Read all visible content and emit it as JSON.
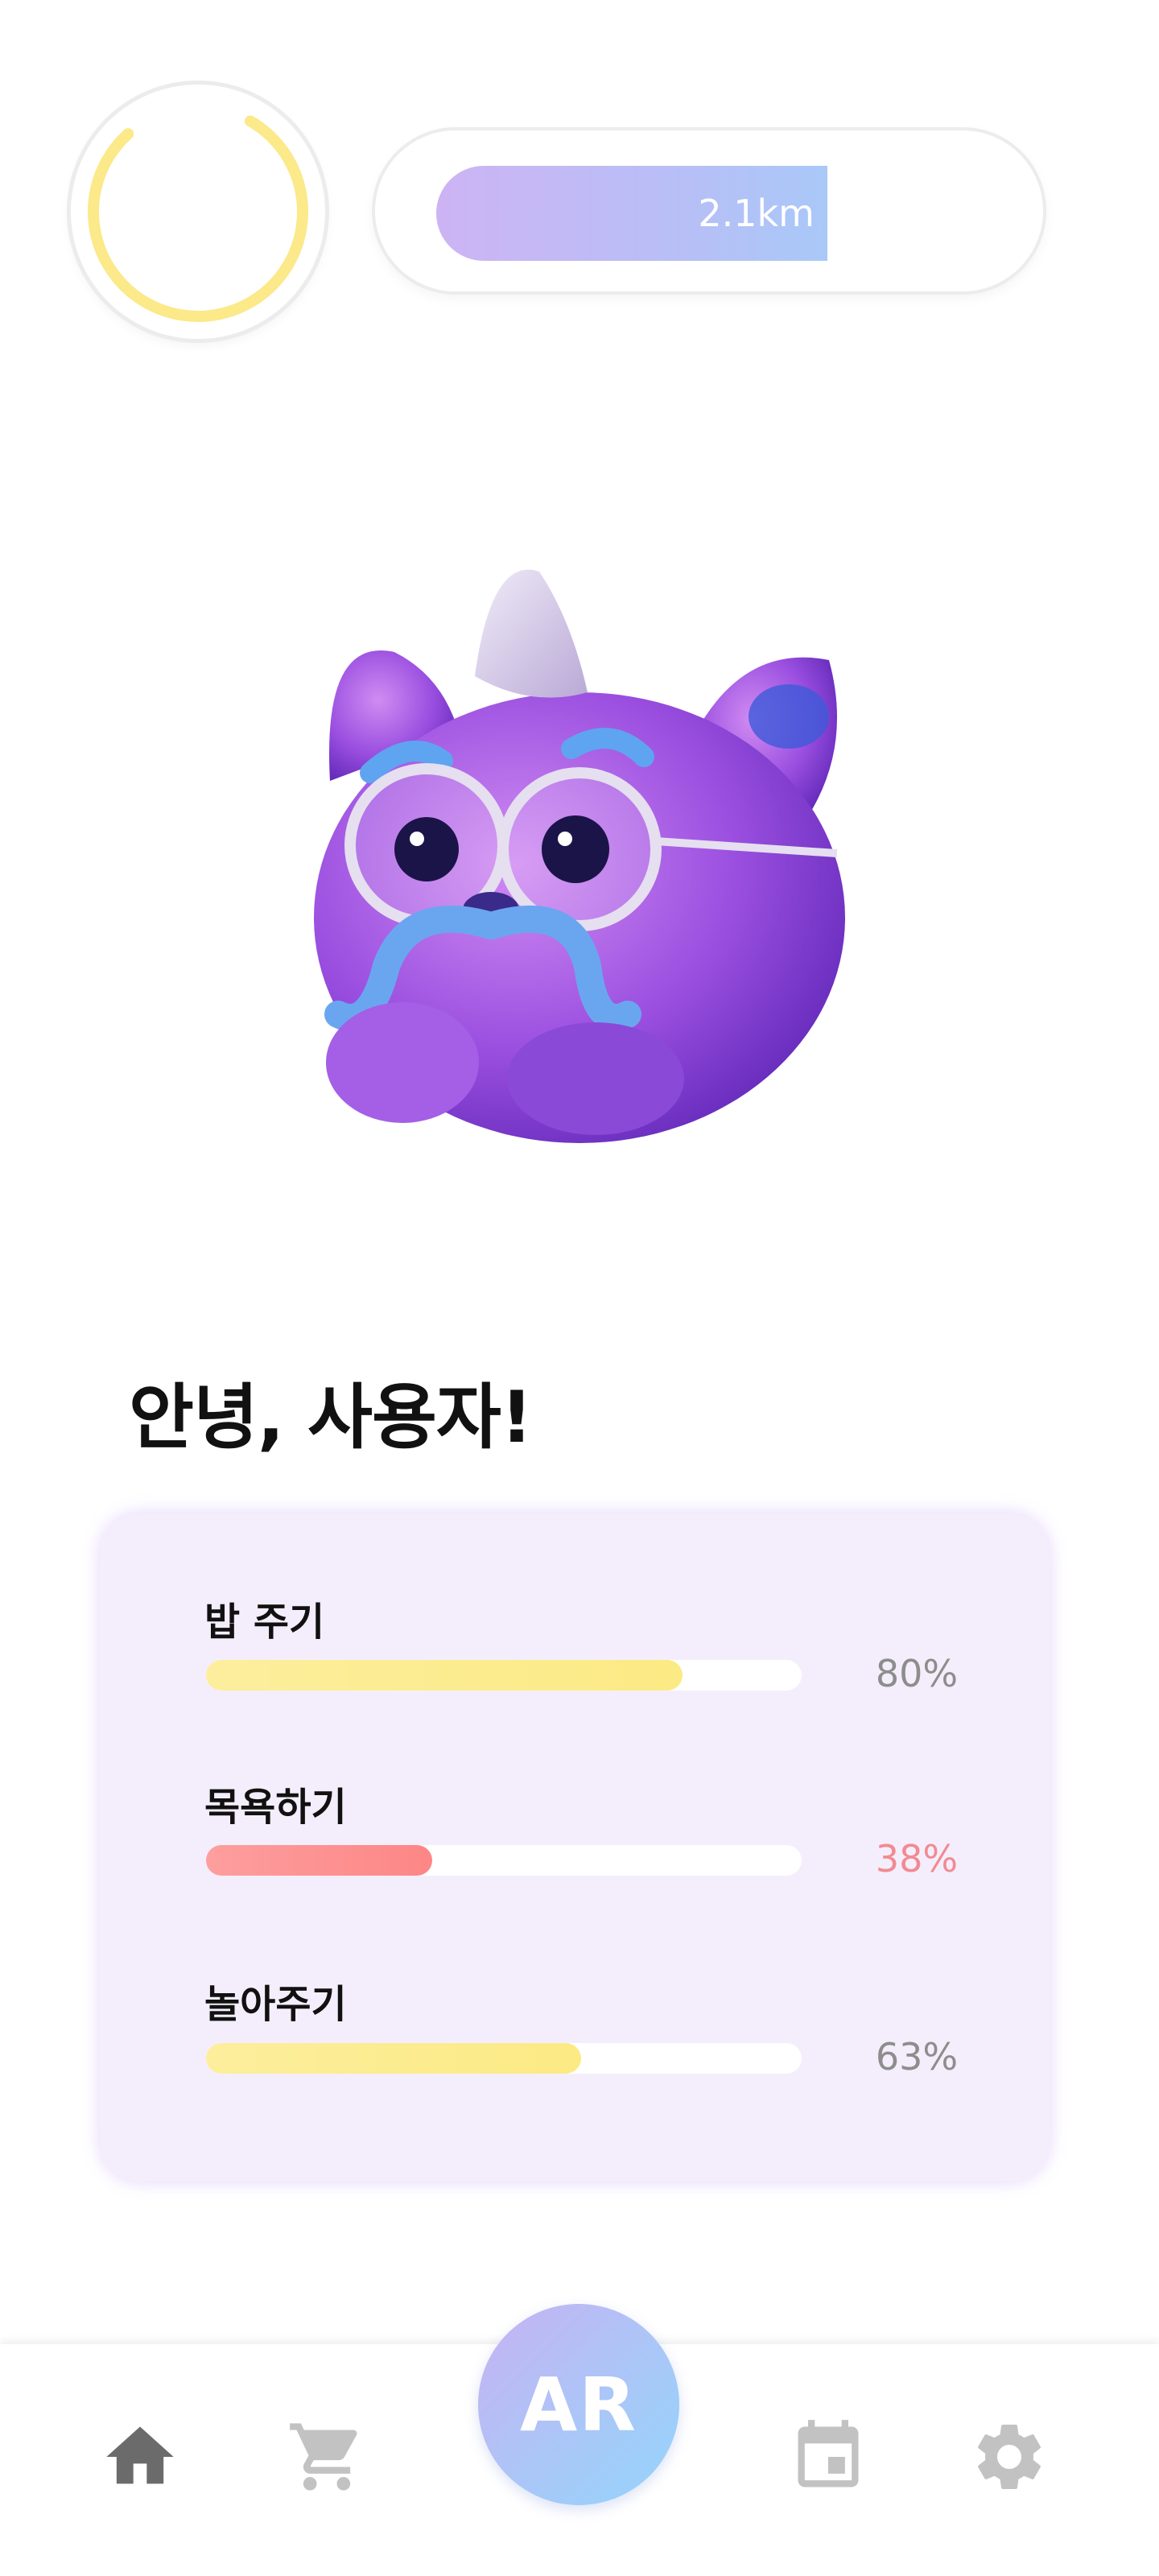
{
  "status": {
    "ring_progress": 0.8,
    "ring_color": "#fbe98a",
    "distance_text": "2.1km",
    "distance_progress": 0.6
  },
  "greeting": "안녕, 사용자!",
  "stats": [
    {
      "label": "밥 주기",
      "percent": 80,
      "percent_text": "80%",
      "color": "#fcea84",
      "text_color": "#8d8d8d"
    },
    {
      "label": "목욕하기",
      "percent": 38,
      "percent_text": "38%",
      "color": "#fd8686",
      "text_color": "#f28a92"
    },
    {
      "label": "놀아주기",
      "percent": 63,
      "percent_text": "63%",
      "color": "#fcea84",
      "text_color": "#8d8d8d"
    }
  ],
  "nav": {
    "items": [
      {
        "icon": "home-icon",
        "active": true
      },
      {
        "icon": "cart-icon",
        "active": false
      },
      {
        "icon": "calendar-icon",
        "active": false
      },
      {
        "icon": "gear-icon",
        "active": false
      }
    ],
    "ar_label": "AR"
  }
}
